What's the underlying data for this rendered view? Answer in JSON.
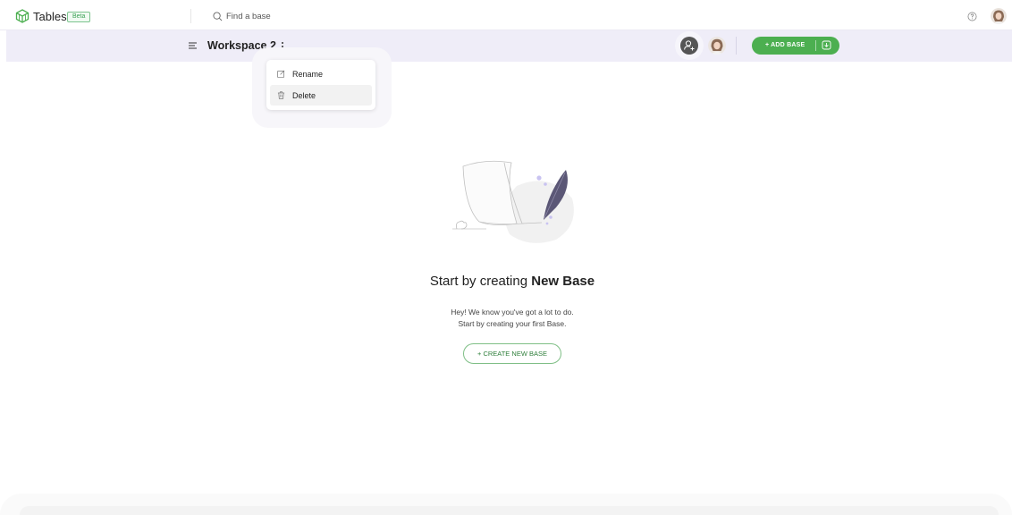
{
  "app": {
    "title": "Tables",
    "badge": "Beta",
    "logo_icon": "cube-logo-icon",
    "brand_color": "#4caf50"
  },
  "search": {
    "placeholder": "Find a base",
    "value": ""
  },
  "header_right": {
    "help_icon": "help-circle-icon",
    "avatar": "user-avatar"
  },
  "workspace": {
    "title": "Workspace 2",
    "menu_icon": "hamburger-icon",
    "options_icon": "kebab-icon",
    "add_user_icon": "add-user-icon",
    "add_base_label": "+ ADD BASE",
    "import_icon": "download-icon",
    "bar_color": "#efedf8"
  },
  "context_menu": {
    "items": [
      {
        "label": "Rename",
        "icon": "edit-icon"
      },
      {
        "label": "Delete",
        "icon": "trash-icon"
      }
    ]
  },
  "empty_state": {
    "title_prefix": "Start by creating ",
    "title_bold": "New Base",
    "line1": "Hey! We know you've got a lot to do.",
    "line2": "Start by creating your first Base.",
    "button_label": "+ CREATE NEW BASE"
  }
}
